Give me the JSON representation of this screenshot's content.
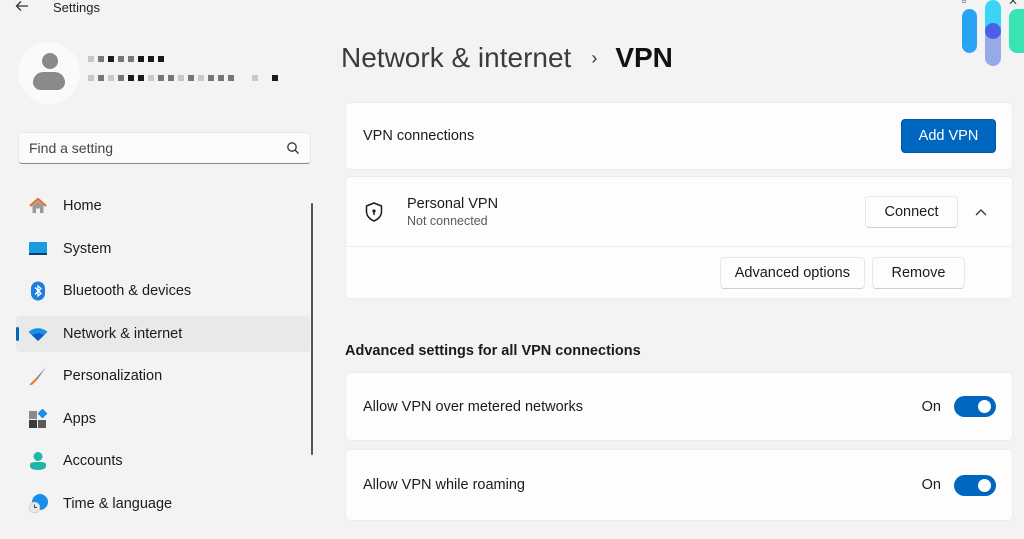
{
  "window": {
    "title": "Settings",
    "back_icon": "arrow-left-icon",
    "controls": [
      "restore-icon",
      "close-icon"
    ]
  },
  "profile": {
    "avatar_icon": "user-avatar-icon",
    "name": "[pixelated]",
    "email": "[pixelated]"
  },
  "search": {
    "placeholder": "Find a setting",
    "value": "",
    "icon": "search-icon"
  },
  "sidebar": {
    "items": [
      {
        "label": "Home",
        "icon": "home-icon",
        "active": false
      },
      {
        "label": "System",
        "icon": "system-display-icon",
        "active": false
      },
      {
        "label": "Bluetooth & devices",
        "icon": "bluetooth-icon",
        "active": false
      },
      {
        "label": "Network & internet",
        "icon": "wifi-icon",
        "active": true
      },
      {
        "label": "Personalization",
        "icon": "paintbrush-icon",
        "active": false
      },
      {
        "label": "Apps",
        "icon": "apps-icon",
        "active": false
      },
      {
        "label": "Accounts",
        "icon": "account-icon",
        "active": false
      },
      {
        "label": "Time & language",
        "icon": "time-language-icon",
        "active": false
      }
    ]
  },
  "header": {
    "breadcrumb_parent": "Network & internet",
    "separator": "›",
    "current": "VPN"
  },
  "vpn_connections": {
    "label": "VPN connections",
    "add_button": "Add VPN"
  },
  "vpn_profile": {
    "icon": "shield-lock-icon",
    "name": "Personal VPN",
    "status": "Not connected",
    "connect_button": "Connect",
    "expanded": true,
    "advanced_button": "Advanced options",
    "remove_button": "Remove"
  },
  "advanced": {
    "title": "Advanced settings for all VPN connections",
    "settings": [
      {
        "label": "Allow VPN over metered networks",
        "state_label": "On",
        "enabled": true
      },
      {
        "label": "Allow VPN while roaming",
        "state_label": "On",
        "enabled": true
      }
    ]
  },
  "colors": {
    "accent": "#0067c0",
    "background": "#f3f3f3",
    "card": "#fdfdfd"
  }
}
